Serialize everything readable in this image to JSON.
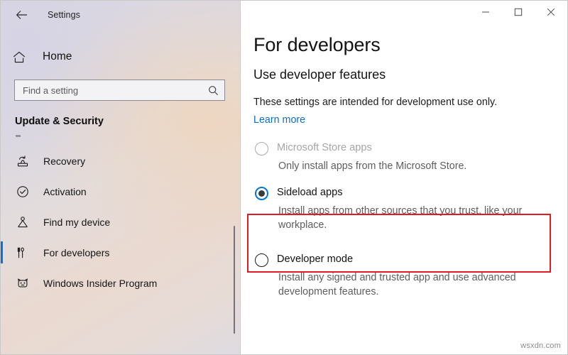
{
  "window": {
    "app_title": "Settings",
    "back_icon": "back-arrow-icon",
    "controls": {
      "minimize": "minimize-icon",
      "maximize": "maximize-icon",
      "close": "close-icon"
    }
  },
  "sidebar": {
    "home": {
      "label": "Home",
      "icon": "home-icon"
    },
    "search": {
      "placeholder": "Find a setting",
      "value": "",
      "icon": "search-icon"
    },
    "section_title": "Update & Security",
    "items": [
      {
        "label": "Recovery",
        "icon": "recovery-icon",
        "selected": false
      },
      {
        "label": "Activation",
        "icon": "check-circle-icon",
        "selected": false
      },
      {
        "label": "Find my device",
        "icon": "find-device-icon",
        "selected": false
      },
      {
        "label": "For developers",
        "icon": "developer-tools-icon",
        "selected": true
      },
      {
        "label": "Windows Insider Program",
        "icon": "ninjacat-icon",
        "selected": false
      }
    ]
  },
  "main": {
    "page_title": "For developers",
    "sub_title": "Use developer features",
    "intro_text": "These settings are intended for development use only.",
    "learn_more_label": "Learn more",
    "options": [
      {
        "label": "Microsoft Store apps",
        "description": "Only install apps from the Microsoft Store.",
        "checked": false,
        "disabled": true
      },
      {
        "label": "Sideload apps",
        "description": "Install apps from other sources that you trust, like your workplace.",
        "checked": true,
        "disabled": false
      },
      {
        "label": "Developer mode",
        "description": "Install any signed and trusted app and use advanced development features.",
        "checked": false,
        "disabled": false
      }
    ]
  },
  "annotation": {
    "highlight_color": "#e01b24",
    "highlight_target": "Sideload apps"
  },
  "watermark": "wsxdn.com",
  "colors": {
    "accent": "#0078d7",
    "link": "#0b70c4",
    "highlight": "#e01b24",
    "disabled_text": "#a5a5a5"
  }
}
